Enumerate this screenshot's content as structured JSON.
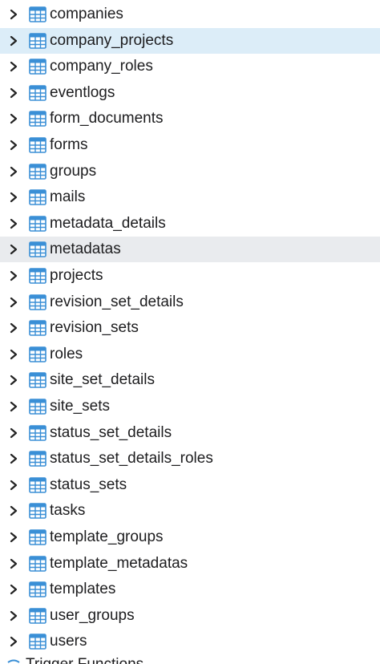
{
  "tables": [
    {
      "name": "companies",
      "state": "normal"
    },
    {
      "name": "company_projects",
      "state": "selected"
    },
    {
      "name": "company_roles",
      "state": "normal"
    },
    {
      "name": "eventlogs",
      "state": "normal"
    },
    {
      "name": "form_documents",
      "state": "normal"
    },
    {
      "name": "forms",
      "state": "normal"
    },
    {
      "name": "groups",
      "state": "normal"
    },
    {
      "name": "mails",
      "state": "normal"
    },
    {
      "name": "metadata_details",
      "state": "normal"
    },
    {
      "name": "metadatas",
      "state": "hovered"
    },
    {
      "name": "projects",
      "state": "normal"
    },
    {
      "name": "revision_set_details",
      "state": "normal"
    },
    {
      "name": "revision_sets",
      "state": "normal"
    },
    {
      "name": "roles",
      "state": "normal"
    },
    {
      "name": "site_set_details",
      "state": "normal"
    },
    {
      "name": "site_sets",
      "state": "normal"
    },
    {
      "name": "status_set_details",
      "state": "normal"
    },
    {
      "name": "status_set_details_roles",
      "state": "normal"
    },
    {
      "name": "status_sets",
      "state": "normal"
    },
    {
      "name": "tasks",
      "state": "normal"
    },
    {
      "name": "template_groups",
      "state": "normal"
    },
    {
      "name": "template_metadatas",
      "state": "normal"
    },
    {
      "name": "templates",
      "state": "normal"
    },
    {
      "name": "user_groups",
      "state": "normal"
    },
    {
      "name": "users",
      "state": "normal"
    }
  ],
  "bottom_item": {
    "label": "Trigger Functions",
    "icon": "trigger-functions-icon"
  },
  "icons": {
    "expander": "chevron-right-icon",
    "table": "table-icon"
  },
  "colors": {
    "selected_bg": "#dcedf8",
    "hover_bg": "#e9ebee",
    "table_icon": "#3a8fd6",
    "text": "#1d1d1f"
  }
}
